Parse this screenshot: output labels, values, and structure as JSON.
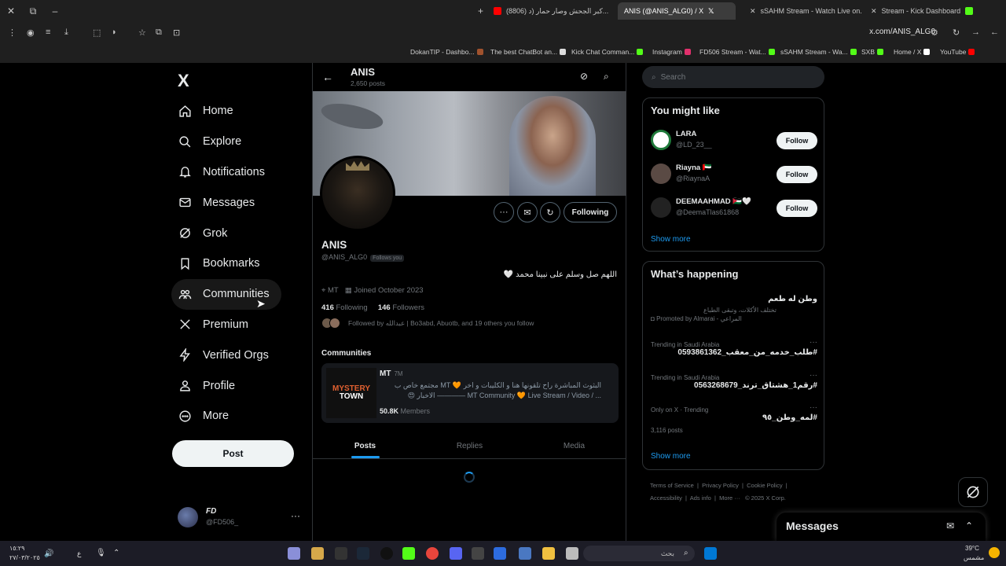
{
  "browser": {
    "tabs": [
      {
        "label": "(8806) كبر الجحش وصار حمار (د...",
        "color": "#ff0000"
      },
      {
        "label": "ANIS (@ANIS_ALG0) / X",
        "color": "#ffffff",
        "active": true
      },
      {
        "label": "sSAHM Stream - Watch Live on...",
        "color": "#53fc18"
      },
      {
        "label": "Stream - Kick Dashboard",
        "color": "#53fc18"
      }
    ],
    "url": "x.com/ANIS_ALG0",
    "bookmarks": [
      "DokanTIP - Dashbo...",
      "The best ChatBot an...",
      "Kick Chat Comman...",
      "Instagram",
      "FD506 Stream - Wat...",
      "sSAHM Stream - Wa...",
      "SXB",
      "Home / X",
      "YouTube"
    ]
  },
  "sidebar": {
    "logo": "X",
    "items": [
      {
        "label": "Home",
        "icon": "home-icon"
      },
      {
        "label": "Explore",
        "icon": "search-icon"
      },
      {
        "label": "Notifications",
        "icon": "bell-icon"
      },
      {
        "label": "Messages",
        "icon": "mail-icon"
      },
      {
        "label": "Grok",
        "icon": "grok-icon"
      },
      {
        "label": "Bookmarks",
        "icon": "bookmark-icon"
      },
      {
        "label": "Communities",
        "icon": "communities-icon"
      },
      {
        "label": "Premium",
        "icon": "x-icon"
      },
      {
        "label": "Verified Orgs",
        "icon": "lightning-icon"
      },
      {
        "label": "Profile",
        "icon": "person-icon"
      },
      {
        "label": "More",
        "icon": "more-circle-icon"
      }
    ],
    "post_label": "Post",
    "account": {
      "name": "FD",
      "handle": "@FD506_"
    }
  },
  "profile": {
    "header_name": "ANIS",
    "header_posts": "2,650 posts",
    "name": "ANIS",
    "handle": "@ANIS_ALG0",
    "follows_you": "Follows you",
    "bio": "اللهم صل وسلم على نبينا محمد 🤍",
    "location": "MT",
    "joined": "Joined October 2023",
    "following_count": "416",
    "following_label": "Following",
    "followers_count": "146",
    "followers_label": "Followers",
    "followed_by": "Followed by عبدالله | Bo3abd, Abuotb, and 19 others you follow",
    "following_btn": "Following",
    "communities_title": "Communities",
    "community": {
      "name": "MT",
      "tag": "7M",
      "logo_line1": "MYSTERY",
      "logo_line2": "TOWN",
      "desc1": "البثوث المباشرة راح تلقونها هنا و الكليبات و اخر 🧡 MT مجتمع خاص ب",
      "desc2": "😍 الاخبار ———— MT Community 🧡 Live Stream / Video / ...",
      "members_count": "50.8K",
      "members_label": "Members"
    },
    "tabs": [
      "Posts",
      "Replies",
      "Media"
    ]
  },
  "right": {
    "search_placeholder": "Search",
    "wtf_title": "You might like",
    "suggestions": [
      {
        "name": "LARA",
        "handle": "@LD_23__",
        "color": "#1f7a3a"
      },
      {
        "name": "Riayna 🇦🇪",
        "handle": "@RiaynaA",
        "color": "#5a4a44"
      },
      {
        "name": "DEEMAAHMAD 🇯🇴🤍",
        "handle": "@DeemaTlas61868",
        "color": "#222222"
      }
    ],
    "follow_label": "Follow",
    "show_more": "Show more",
    "happening_title": "What’s happening",
    "trends": [
      {
        "context": "",
        "title": "وطن له طعم",
        "sub": "تختلف الأكلات، وتبقى الطباع",
        "promo": "Promoted by Almarai - المراعي"
      },
      {
        "context": "Trending in Saudi Arabia",
        "title": "#طلب_خدمه_من_معقب_0593861362"
      },
      {
        "context": "Trending in Saudi Arabia",
        "title": "#رقم1_هشتاق_ترند_0563268679"
      },
      {
        "context": "Only on X · Trending",
        "title": "#لمه_وطن_٩٥",
        "count": "3,116 posts"
      }
    ],
    "footer": [
      "Terms of Service",
      "Privacy Policy",
      "Cookie Policy",
      "Accessibility",
      "Ads info",
      "More ···",
      "© 2025 X Corp."
    ],
    "messages_title": "Messages"
  },
  "taskbar": {
    "search": "بحث",
    "time": "١٥:٢٩",
    "date": "٢٧/٠٣/٢٠٢٥",
    "weather": "39°C",
    "weather_desc": "مشمس",
    "lang": "ع"
  }
}
